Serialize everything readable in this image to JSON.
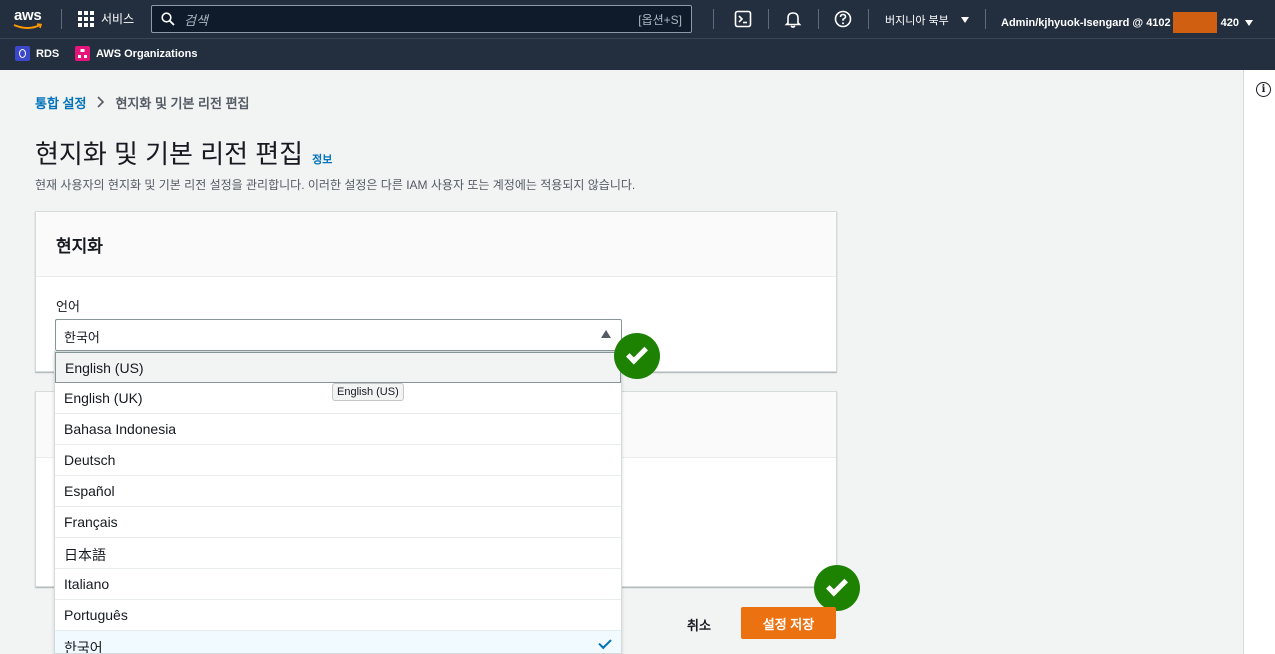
{
  "nav": {
    "logo": "aws",
    "services": "서비스",
    "search_placeholder": "검색",
    "search_shortcut": "[옵션+S]",
    "region": "버지니아 북부",
    "account_prefix": "Admin/kjhyuok-Isengard @ 4102",
    "account_suffix": "420"
  },
  "favorites": [
    {
      "label": "RDS",
      "color": "#3b48cc"
    },
    {
      "label": "AWS Organizations",
      "color": "#e7157b"
    }
  ],
  "breadcrumb": {
    "parent": "통합 설정",
    "current": "현지화 및 기본 리전 편집"
  },
  "page": {
    "title": "현지화 및 기본 리전 편집",
    "info": "정보",
    "description": "현재 사용자의 현지화 및 기본 리전 설정을 관리합니다. 이러한 설정은 다른 IAM 사용자 또는 계정에는 적용되지 않습니다."
  },
  "localization": {
    "heading": "현지화",
    "language_label": "언어",
    "language_value": "한국어"
  },
  "dropdown": {
    "options": [
      "English (US)",
      "English (UK)",
      "Bahasa Indonesia",
      "Deutsch",
      "Español",
      "Français",
      "日本語",
      "Italiano",
      "Português",
      "한국어"
    ],
    "hovered": "English (US)",
    "selected": "한국어",
    "tooltip": "English (US)"
  },
  "actions": {
    "cancel": "취소",
    "save": "설정 저장"
  },
  "colors": {
    "nav_bg": "#232f3e",
    "accent": "#ec7211",
    "link": "#0073bb",
    "check_badge": "#1d8102"
  }
}
